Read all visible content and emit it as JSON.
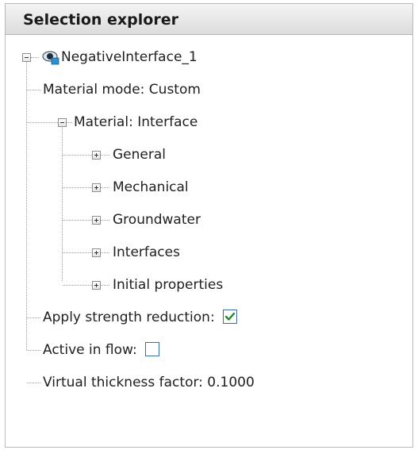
{
  "panel": {
    "title": "Selection explorer"
  },
  "tree": {
    "root": {
      "label": "NegativeInterface_1",
      "icon": "interface-object-icon"
    },
    "material_mode": "Material mode: Custom",
    "material": {
      "label": "Material: Interface",
      "children": [
        "General",
        "Mechanical",
        "Groundwater",
        "Interfaces",
        "Initial properties"
      ]
    },
    "apply_strength_reduction": {
      "label": "Apply strength reduction:",
      "checked": true
    },
    "active_in_flow": {
      "label": "Active in flow:",
      "checked": false
    },
    "virtual_thickness_factor": "Virtual thickness factor: 0.1000"
  },
  "colors": {
    "check": "#1f8a2a",
    "checkbox_border": "#3a6ea5"
  }
}
